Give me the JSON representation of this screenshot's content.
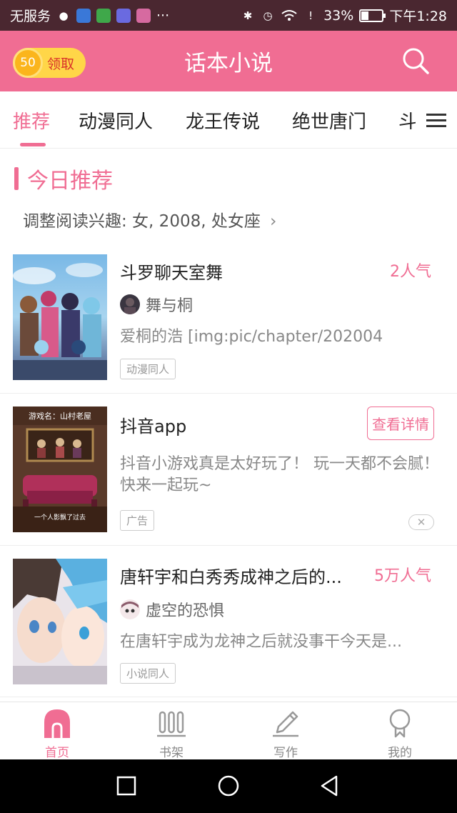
{
  "status_bar": {
    "carrier": "无服务",
    "battery": "33%",
    "battery_level": 0.33,
    "time": "下午1:28"
  },
  "header": {
    "title": "话本小说",
    "coin_count": "50",
    "coin_label": "领取"
  },
  "tabs": [
    {
      "label": "推荐",
      "active": true
    },
    {
      "label": "动漫同人"
    },
    {
      "label": "龙王传说"
    },
    {
      "label": "绝世唐门"
    },
    {
      "label": "斗罗"
    }
  ],
  "section": {
    "title": "今日推荐",
    "interest": "调整阅读兴趣: 女, 2008, 处女座"
  },
  "cards": [
    {
      "title": "斗罗聊天室舞",
      "popularity": "2人气",
      "author": "舞与桐",
      "description": "爱桐的浩 [img:pic/chapter/202004",
      "tag": "动漫同人"
    },
    {
      "title": "抖音app",
      "button": "查看详情",
      "description": "抖音小游戏真是太好玩了！ 玩一天都不会腻！ 快来一起玩~",
      "tag": "广告",
      "thumb_top_text": "游戏名：山村老屋",
      "thumb_bottom_text": "一个人影飘了过去"
    },
    {
      "title": "唐轩宇和白秀秀成神之后的...",
      "popularity": "5万人气",
      "author": "虚空的恐惧",
      "description": "在唐轩宇成为龙神之后就没事干今天是...",
      "tag": "小说同人"
    }
  ],
  "bottom_nav": [
    {
      "label": "首页",
      "icon": "home-icon",
      "active": true
    },
    {
      "label": "书架",
      "icon": "bookshelf-icon"
    },
    {
      "label": "写作",
      "icon": "pencil-icon"
    },
    {
      "label": "我的",
      "icon": "profile-icon"
    }
  ],
  "colors": {
    "accent": "#f06d93",
    "status_bar": "#4a2730",
    "coin": "#fbb51c"
  }
}
